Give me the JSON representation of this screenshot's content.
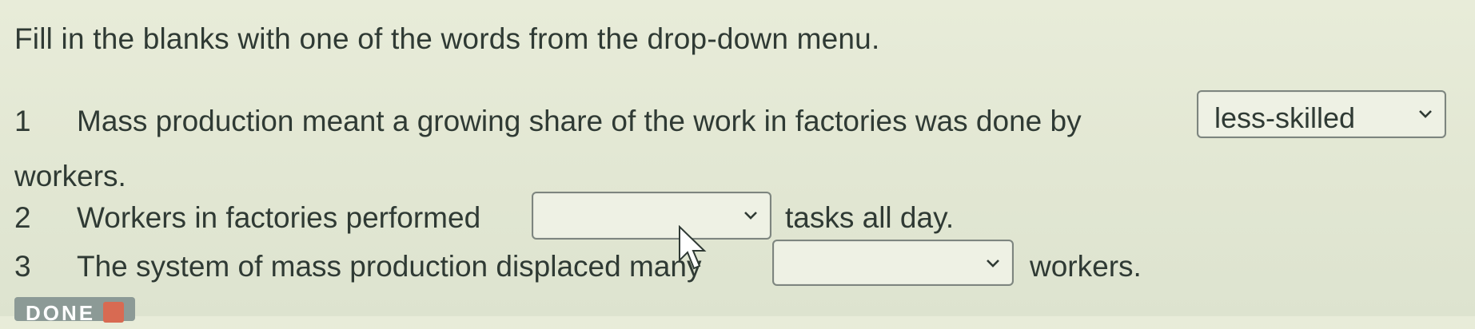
{
  "instructions": "Fill in the blanks with one of the words from the drop-down menu.",
  "questions": [
    {
      "number": "1",
      "text_before": "Mass production meant a growing share of the work in factories was done by",
      "selected": "less-skilled",
      "text_after": "workers."
    },
    {
      "number": "2",
      "text_before": "Workers in factories performed",
      "selected": "",
      "text_after": "tasks all day."
    },
    {
      "number": "3",
      "text_before": "The system of mass production displaced many",
      "selected": "",
      "text_after": "workers."
    }
  ],
  "done_button": {
    "label": "DONE"
  },
  "icons": {
    "dropdown": "chevron-down-icon",
    "cursor": "mouse-pointer-icon",
    "done": "checkmark-icon"
  }
}
